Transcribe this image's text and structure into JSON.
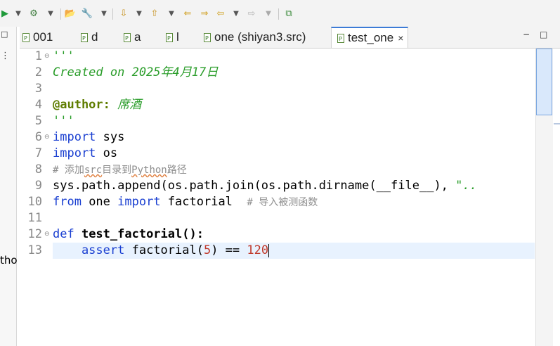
{
  "toolbar": {
    "icons": [
      "run-icon",
      "run-dropdown-icon",
      "debug-icon",
      "debug-dropdown-icon",
      "open-folder-icon",
      "wrench-icon",
      "tool-dropdown-icon",
      "next-annotation-icon",
      "next-dropdown-icon",
      "prev-annotation-icon",
      "prev-dropdown-icon",
      "last-edit-icon",
      "forward-edit-icon",
      "back-icon",
      "back-dropdown-icon",
      "forward-icon",
      "forward-dropdown-icon",
      "new-window-icon"
    ]
  },
  "left_pane": {
    "text": "tho",
    "minimize": "−",
    "maximize": "□",
    "menu": "⋮"
  },
  "tabs": [
    {
      "label": "001",
      "active": false
    },
    {
      "label": "d",
      "active": false
    },
    {
      "label": "a",
      "active": false
    },
    {
      "label": "l",
      "active": false
    },
    {
      "label": "one (shiyan3.src)",
      "active": false
    },
    {
      "label": "test_one",
      "active": true,
      "close": "×"
    }
  ],
  "editor_controls": {
    "minimize": "−",
    "maximize": "□"
  },
  "editor": {
    "line_numbers": [
      "1",
      "2",
      "3",
      "4",
      "5",
      "6",
      "7",
      "8",
      "9",
      "10",
      "11",
      "12",
      "13"
    ],
    "line1": "'''",
    "line2": "Created on 2025年4月17日",
    "line4_tag": "@author:",
    "line4_name": " 席酒",
    "line5": "'''",
    "line6_kw": "import",
    "line6_rest": " sys",
    "line7_kw": "import",
    "line7_rest": " os",
    "line8_a": "# 添加",
    "line8_b": "src",
    "line8_c": "目录到",
    "line8_d": "Python",
    "line8_e": "路径",
    "line9_a": "sys.path.append(os.path.join(os.path.dirname(__file__), ",
    "line9_b": "\"..",
    "line10_kw1": "from",
    "line10_mid": " one ",
    "line10_kw2": "import",
    "line10_rest": " factorial  ",
    "line10_cmt": "# 导入被测函数",
    "line12_kw": "def",
    "line12_fn": " test_factorial",
    "line12_rest": "():",
    "line13_kw": "    assert",
    "line13_mid": " factorial(",
    "line13_arg": "5",
    "line13_op": ") == ",
    "line13_num": "120"
  },
  "colors": {
    "keyword": "#1a3fd1",
    "string": "#2a9d2a",
    "decorator": "#5f7d00",
    "comment": "#8e8e8e",
    "number": "#c0392b",
    "current_line": "#e8f2fe",
    "active_tab_accent": "#3c7bd6"
  }
}
